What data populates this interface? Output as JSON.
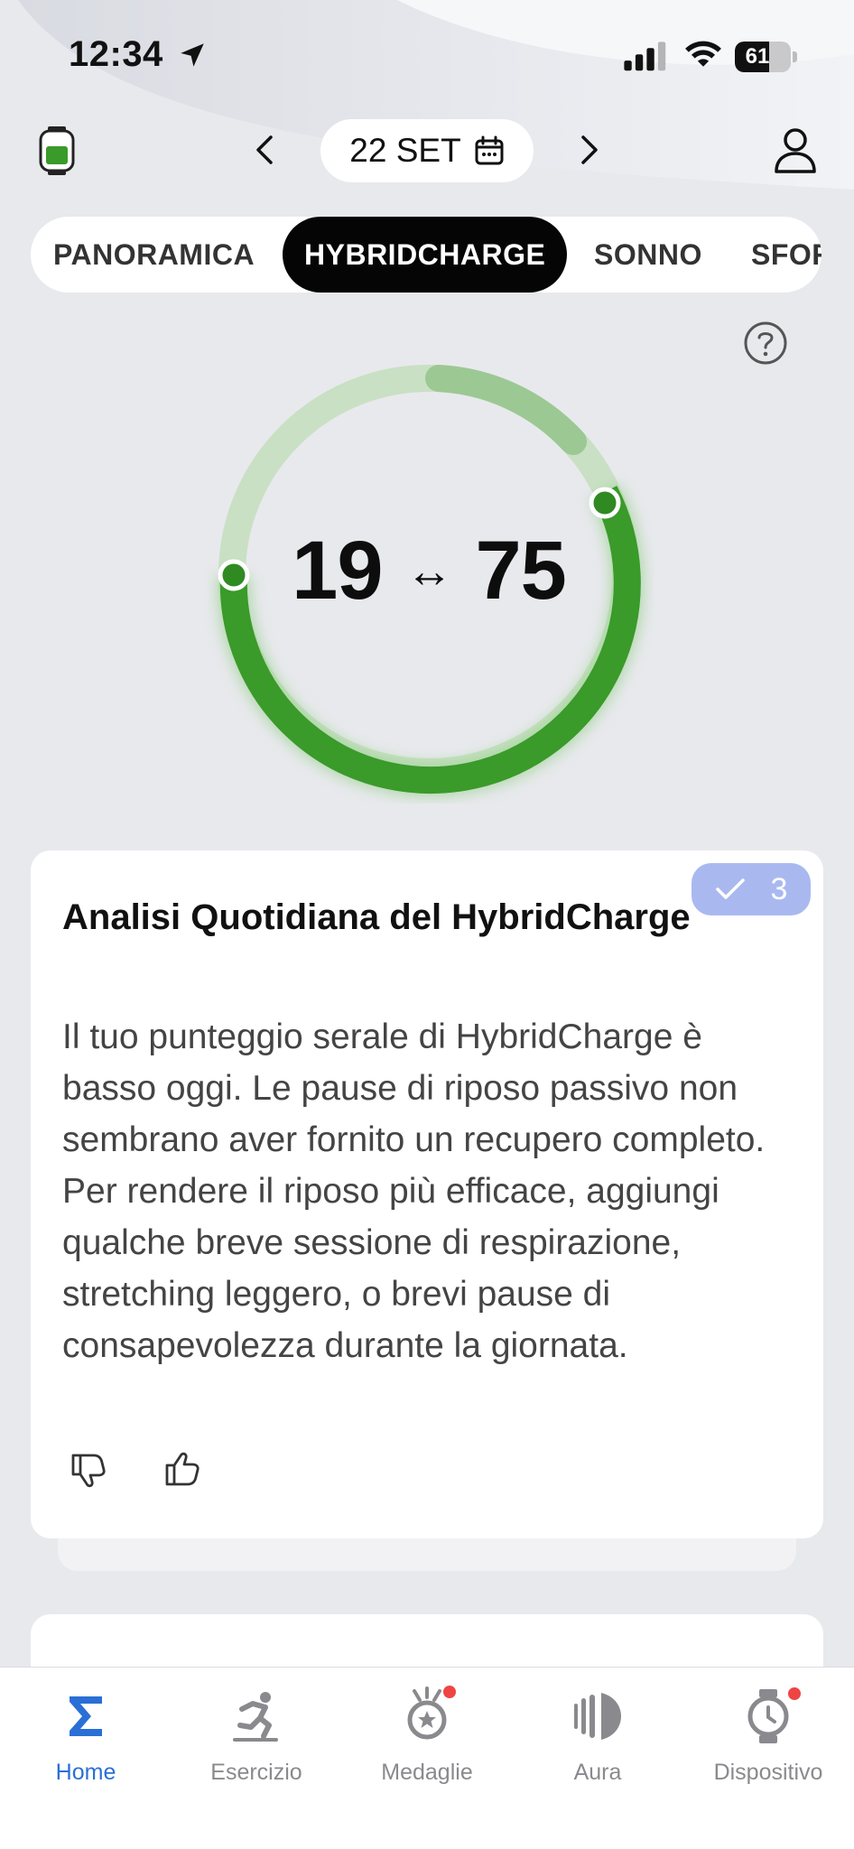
{
  "status_bar": {
    "time": "12:34",
    "battery_level": "61"
  },
  "header": {
    "date": "22 SET"
  },
  "tabs": [
    {
      "label": "PANORAMICA"
    },
    {
      "label": "HYBRIDCHARGE"
    },
    {
      "label": "SONNO"
    },
    {
      "label": "SFOR"
    }
  ],
  "gauge": {
    "low": "19",
    "arrow": "↔",
    "high": "75",
    "arc_color": "#3a9a2a"
  },
  "card": {
    "badge_count": "3",
    "title": "Analisi Quotidiana del HybridCharge",
    "body": "Il tuo punteggio serale di HybridCharge è basso oggi. Le pause di riposo passivo non sembrano aver fornito un recupero completo. Per rendere il riposo più efficace, aggiungi qualche breve sessione di respirazione, stretching leggero, o brevi pause di consapevolezza durante la giornata."
  },
  "bottom_nav": [
    {
      "label": "Home",
      "icon": "sigma-icon",
      "active": true
    },
    {
      "label": "Esercizio",
      "icon": "runner-icon"
    },
    {
      "label": "Medaglie",
      "icon": "medal-icon"
    },
    {
      "label": "Aura",
      "icon": "aura-icon"
    },
    {
      "label": "Dispositivo",
      "icon": "watch-device-icon"
    }
  ],
  "colors": {
    "accent": "#2a6fd6",
    "green": "#3a9a2a",
    "badge": "#a9b9f0",
    "notification": "#ef4444"
  }
}
